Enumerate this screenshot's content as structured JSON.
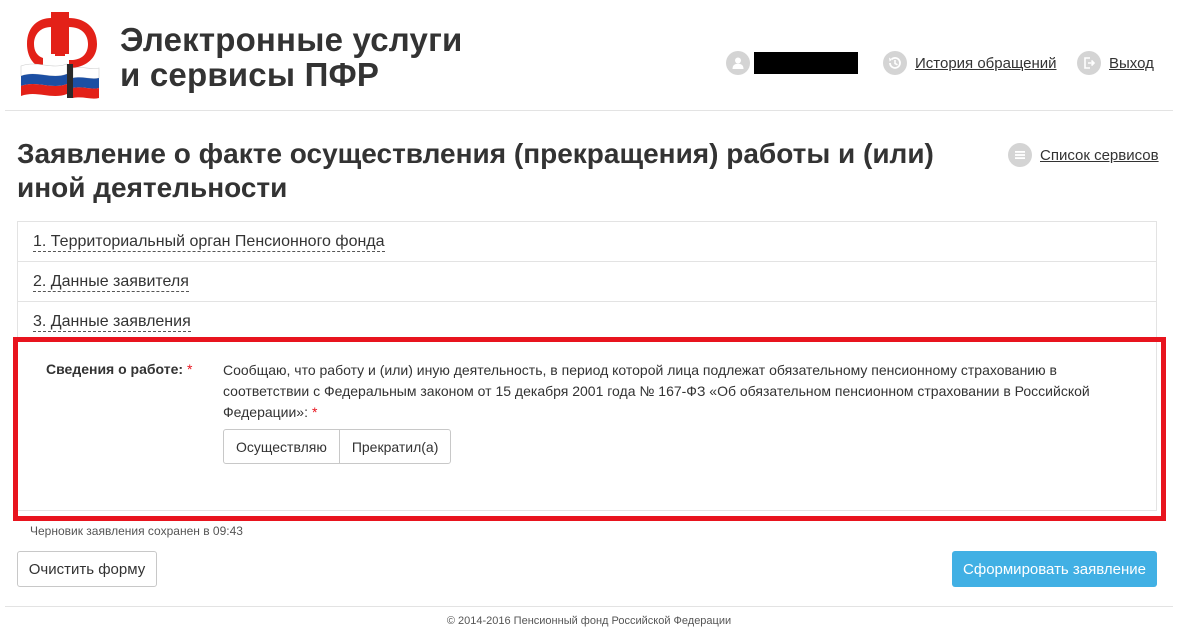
{
  "header": {
    "title_line1": "Электронные услуги",
    "title_line2": "и сервисы ПФР",
    "logo_icon": "pfr-logo-icon",
    "user_icon": "user-icon",
    "history_link": "История обращений",
    "history_icon": "history-icon",
    "exit_link": "Выход",
    "exit_icon": "exit-icon"
  },
  "page": {
    "title_line1": "Заявление о факте осуществления (прекращения) работы и (или)",
    "title_line2": "иной деятельности",
    "services_link": "Список сервисов",
    "services_icon": "list-icon"
  },
  "sections": [
    {
      "title": "1. Территориальный орган Пенсионного фонда"
    },
    {
      "title": "2. Данные заявителя"
    },
    {
      "title": "3. Данные заявления"
    }
  ],
  "work_info": {
    "label": "Сведения о работе:",
    "required_mark": "*",
    "text": "Сообщаю, что работу и (или) иную деятельность, в период которой лица подлежат обязательному пенсионному страхованию в соответствии с Федеральным законом от 15 декабря 2001 года № 167-ФЗ «Об обязательном пенсионном страховании в Российской Федерации»:",
    "options": [
      "Осуществляю",
      "Прекратил(а)"
    ]
  },
  "form_footer": {
    "draft_status": "Черновик заявления сохранен в 09:43",
    "clear_button": "Очистить форму",
    "submit_button": "Сформировать заявление"
  },
  "footer": {
    "copyright": "© 2014-2016 Пенсионный фонд Российской Федерации"
  },
  "colors": {
    "accent": "#41b0e4",
    "highlight": "#e8141e",
    "logo_red": "#e32118",
    "flag_blue": "#1c4fa3"
  }
}
